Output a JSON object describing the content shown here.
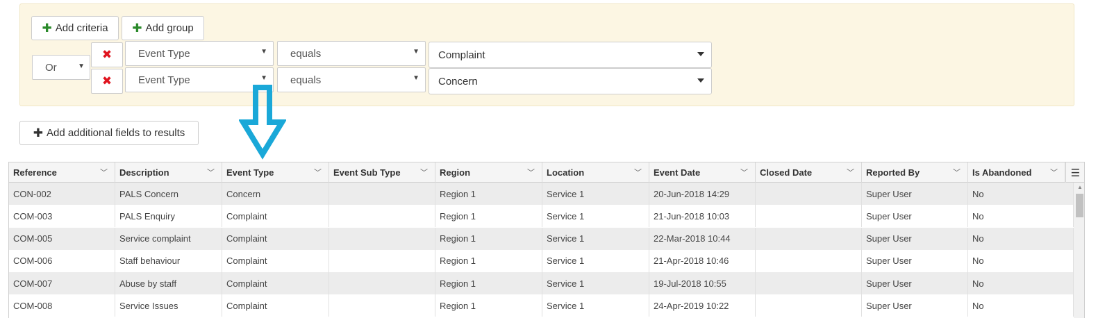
{
  "criteria": {
    "add_criteria_label": "Add criteria",
    "add_group_label": "Add group",
    "logic_operator": "Or",
    "rows": [
      {
        "field": "Event Type",
        "operator": "equals",
        "value": "Complaint"
      },
      {
        "field": "Event Type",
        "operator": "equals",
        "value": "Concern"
      }
    ]
  },
  "add_fields_label": "Add additional fields to results",
  "colors": {
    "panel_bg": "#fcf6e3",
    "arrow": "#1aa8d8",
    "remove": "#e0141e",
    "add_green": "#2b8a2b",
    "row_alt": "#ececec"
  },
  "grid": {
    "columns": [
      "Reference",
      "Description",
      "Event Type",
      "Event Sub Type",
      "Region",
      "Location",
      "Event Date",
      "Closed Date",
      "Reported By",
      "Is Abandoned"
    ],
    "rows": [
      [
        "CON-002",
        "PALS Concern",
        "Concern",
        "",
        "Region 1",
        "Service 1",
        "20-Jun-2018 14:29",
        "",
        "Super User",
        "No"
      ],
      [
        "COM-003",
        "PALS Enquiry",
        "Complaint",
        "",
        "Region 1",
        "Service 1",
        "21-Jun-2018 10:03",
        "",
        "Super User",
        "No"
      ],
      [
        "COM-005",
        "Service complaint",
        "Complaint",
        "",
        "Region 1",
        "Service 1",
        "22-Mar-2018 10:44",
        "",
        "Super User",
        "No"
      ],
      [
        "COM-006",
        "Staff behaviour",
        "Complaint",
        "",
        "Region 1",
        "Service 1",
        "21-Apr-2018 10:46",
        "",
        "Super User",
        "No"
      ],
      [
        "COM-007",
        "Abuse by staff",
        "Complaint",
        "",
        "Region 1",
        "Service 1",
        "19-Jul-2018 10:55",
        "",
        "Super User",
        "No"
      ],
      [
        "COM-008",
        "Service Issues",
        "Complaint",
        "",
        "Region 1",
        "Service 1",
        "24-Apr-2019 10:22",
        "",
        "Super User",
        "No"
      ]
    ]
  }
}
